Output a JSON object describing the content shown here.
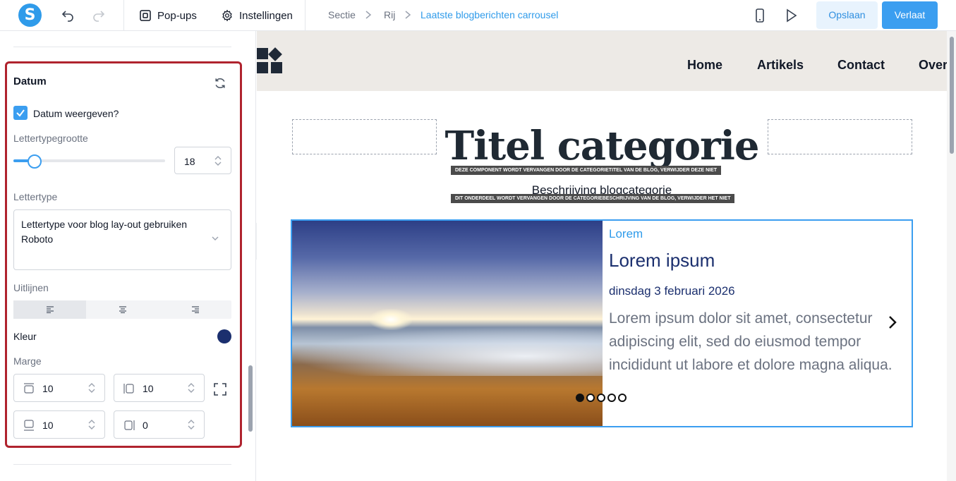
{
  "toolbar": {
    "logo_letter": "S",
    "popups_label": "Pop-ups",
    "settings_label": "Instellingen",
    "breadcrumb": [
      "Sectie",
      "Rij",
      "Laatste blogberichten carrousel"
    ],
    "save_label": "Opslaan",
    "leave_label": "Verlaat"
  },
  "panel": {
    "section_title": "Datum",
    "show_date_label": "Datum weergeven?",
    "show_date_checked": true,
    "font_size_label": "Lettertypegrootte",
    "font_size_value": "18",
    "font_size_slider_fraction": 0.14,
    "font_label": "Lettertype",
    "font_select_line1": "Lettertype voor blog lay-out gebruiken",
    "font_select_line2": "Roboto",
    "align_label": "Uitlijnen",
    "align_selected": "left",
    "color_label": "Kleur",
    "color_value": "#1b2f6e",
    "margin_label": "Marge",
    "margin": {
      "top": "10",
      "right": "10",
      "bottom": "10",
      "left": "0"
    }
  },
  "preview": {
    "nav": [
      "Home",
      "Artikels",
      "Contact",
      "Over"
    ],
    "category_title": "Titel categorie",
    "title_note": "DEZE COMPONENT WORDT VERVANGEN DOOR DE CATEGORIETITEL VAN DE BLOG, VERWIJDER DEZE NIET",
    "category_description": "Beschrijving blogcategorie",
    "description_note": "DIT ONDERDEEL WORDT VERVANGEN DOOR DE CATEGORIEBESCHRIJVING VAN DE BLOG, VERWIJDER HET NIET",
    "card": {
      "category": "Lorem",
      "title": "Lorem ipsum",
      "date": "dinsdag 3 februari 2026",
      "excerpt": "Lorem ipsum dolor sit amet, consectetur adipiscing elit, sed do eiusmod tempor incididunt ut labore et dolore magna aliqua."
    },
    "slides_total": 5,
    "slide_active": 1
  }
}
